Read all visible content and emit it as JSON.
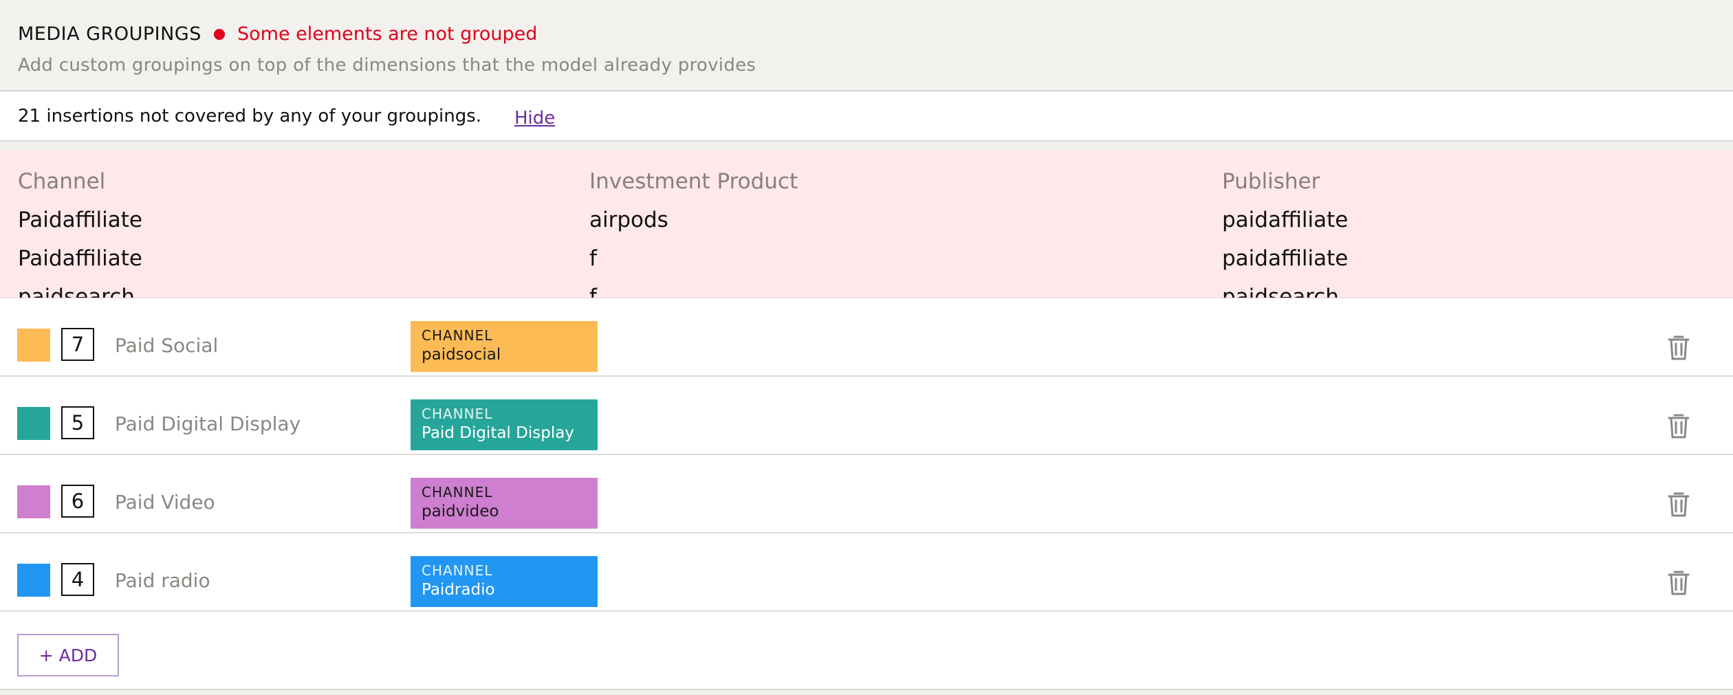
{
  "header": {
    "title": "MEDIA GROUPINGS",
    "warning": "Some elements are not grouped",
    "subtitle": "Add custom groupings on top of the dimensions that the model already provides",
    "warning_color": "#e0001b"
  },
  "notice": {
    "text": "21 insertions not covered by any of your groupings.",
    "link": "Hide"
  },
  "uncovered_table": {
    "columns": [
      "Channel",
      "Investment Product",
      "Publisher"
    ],
    "rows": [
      [
        "Paidaffiliate",
        "airpods",
        "paidaffiliate"
      ],
      [
        "Paidaffiliate",
        "f",
        "paidaffiliate"
      ],
      [
        "paidsearch",
        "f",
        "paidsearch"
      ]
    ]
  },
  "groups": [
    {
      "color": "#fdbb55",
      "order": "7",
      "name": "Paid Social",
      "chip_label": "CHANNEL",
      "chip_value": "paidsocial",
      "icon": "trash-icon"
    },
    {
      "color": "#26a69a",
      "order": "5",
      "name": "Paid Digital Display",
      "chip_label": "CHANNEL",
      "chip_value": "Paid Digital Display",
      "icon": "trash-icon"
    },
    {
      "color": "#ce7fcf",
      "order": "6",
      "name": "Paid Video",
      "chip_label": "CHANNEL",
      "chip_value": "paidvideo",
      "icon": "trash-icon"
    },
    {
      "color": "#2196f3",
      "order": "4",
      "name": "Paid radio",
      "chip_label": "CHANNEL",
      "chip_value": "Paidradio",
      "icon": "trash-icon"
    }
  ],
  "add_button": "+ ADD",
  "colors": {
    "accent": "#6a2c9e",
    "uncovered_bg": "#ffe8ea"
  }
}
